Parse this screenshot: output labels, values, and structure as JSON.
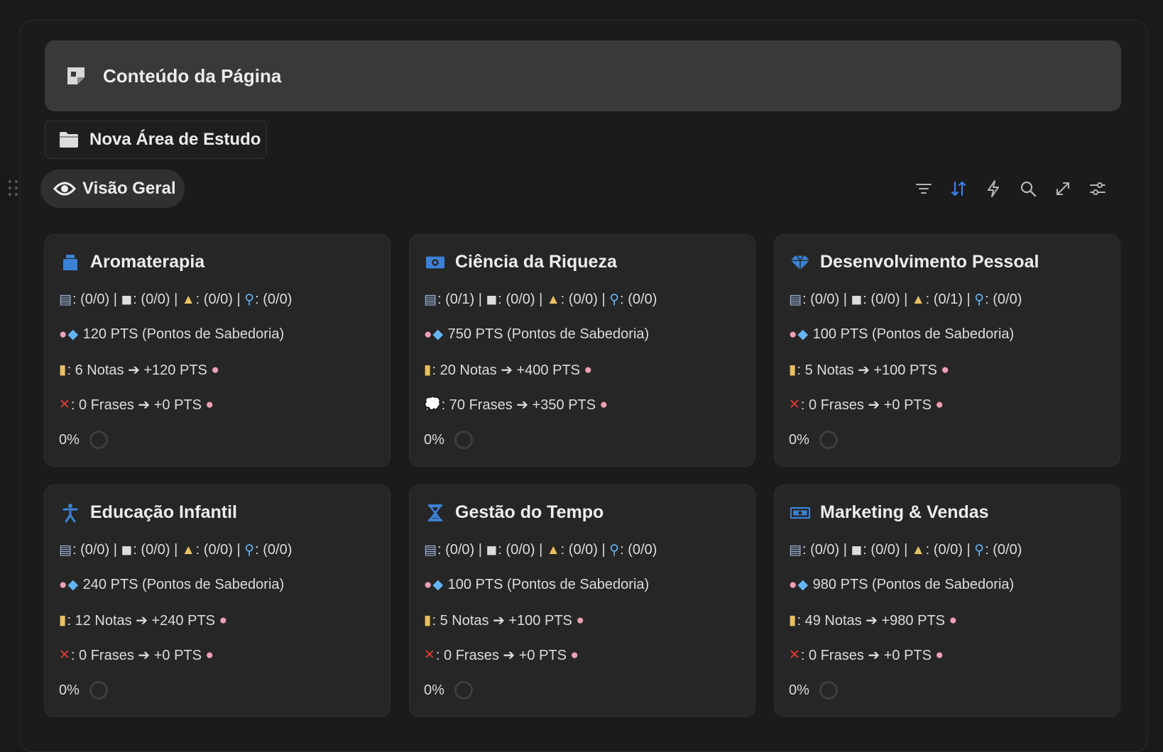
{
  "callout": {
    "title": "Conteúdo da Página",
    "icon": "note-icon"
  },
  "new_area": {
    "label": "Nova Área de Estudo",
    "icon": "folder-icon"
  },
  "view_tab": {
    "label": "Visão Geral",
    "icon": "eye-icon"
  },
  "toolbar": {
    "items": [
      "filter-icon",
      "sort-icon",
      "automation-icon",
      "search-icon",
      "expand-icon",
      "settings-sliders-icon"
    ],
    "active_color": "#3b82f6"
  },
  "cards": [
    {
      "title": "Aromaterapia",
      "icon": "ink-bottle-icon",
      "stats": ": (0/0)  |  : (0/0)  |  : (0/0)  |  : (0/0)",
      "s1": ": (0/0)",
      "s2": ": (0/0)",
      "s3": ": (0/0)",
      "s4": ": (0/0)",
      "points": "120 PTS (Pontos de Sabedoria)",
      "notes": ": 6 Notas ➔ +120 PTS",
      "phrases": ": 0 Frases ➔ +0 PTS",
      "phrases_icon": "cross-icon",
      "progress": "0%"
    },
    {
      "title": "Ciência da Riqueza",
      "icon": "money-icon",
      "s1": ": (0/1)",
      "s2": ": (0/0)",
      "s3": ": (0/0)",
      "s4": ": (0/0)",
      "points": "750 PTS (Pontos de Sabedoria)",
      "notes": ": 20 Notas ➔ +400 PTS",
      "phrases": ": 70 Frases ➔ +350 PTS",
      "phrases_icon": "speech-bubble-icon",
      "progress": "0%"
    },
    {
      "title": "Desenvolvimento Pessoal",
      "icon": "diamond-icon",
      "s1": ": (0/0)",
      "s2": ": (0/0)",
      "s3": ": (0/1)",
      "s4": ": (0/0)",
      "points": "100 PTS (Pontos de Sabedoria)",
      "notes": ": 5 Notas ➔ +100 PTS",
      "phrases": ": 0 Frases ➔ +0 PTS",
      "phrases_icon": "cross-icon",
      "progress": "0%"
    },
    {
      "title": "Educação Infantil",
      "icon": "child-icon",
      "s1": ": (0/0)",
      "s2": ": (0/0)",
      "s3": ": (0/0)",
      "s4": ": (0/0)",
      "points": "240 PTS (Pontos de Sabedoria)",
      "notes": ": 12 Notas ➔ +240 PTS",
      "phrases": ": 0 Frases ➔ +0 PTS",
      "phrases_icon": "cross-icon",
      "progress": "0%"
    },
    {
      "title": "Gestão do Tempo",
      "icon": "hourglass-icon",
      "s1": ": (0/0)",
      "s2": ": (0/0)",
      "s3": ": (0/0)",
      "s4": ": (0/0)",
      "points": "100 PTS (Pontos de Sabedoria)",
      "notes": ": 5 Notas ➔ +100 PTS",
      "phrases": ": 0 Frases ➔ +0 PTS",
      "phrases_icon": "cross-icon",
      "progress": "0%"
    },
    {
      "title": "Marketing & Vendas",
      "icon": "cash-register-icon",
      "s1": ": (0/0)",
      "s2": ": (0/0)",
      "s3": ": (0/0)",
      "s4": ": (0/0)",
      "points": "980 PTS (Pontos de Sabedoria)",
      "notes": ": 49 Notas ➔ +980 PTS",
      "phrases": ": 0 Frases ➔ +0 PTS",
      "phrases_icon": "cross-icon",
      "progress": "0%"
    }
  ]
}
